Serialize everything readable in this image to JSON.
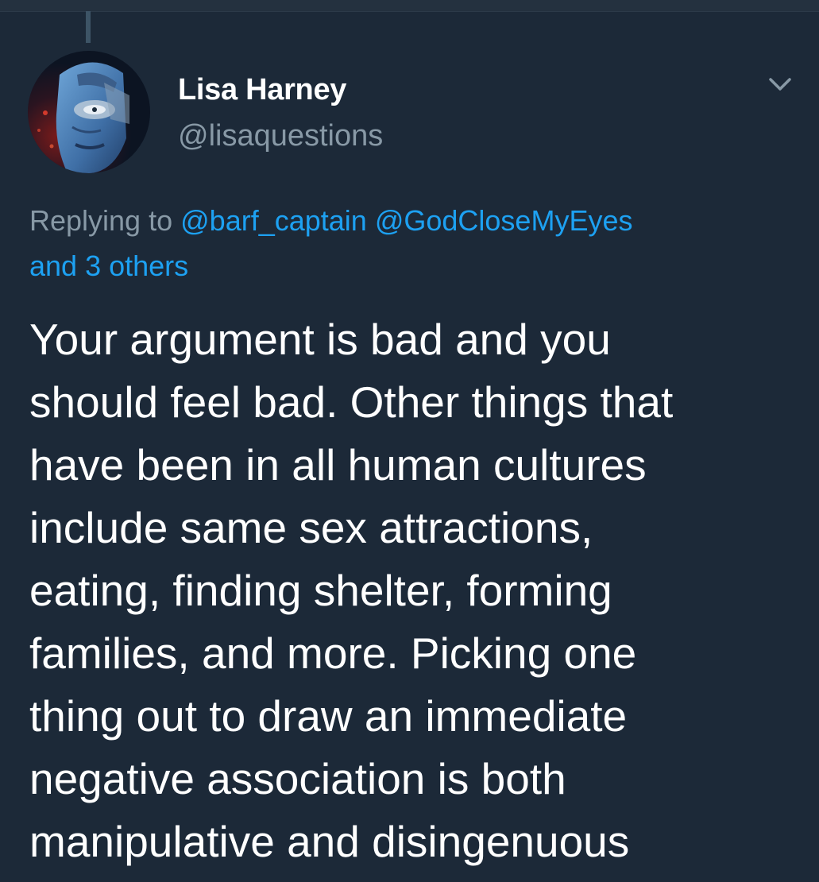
{
  "tweet": {
    "author": {
      "display_name": "Lisa Harney",
      "handle": "@lisaquestions",
      "avatar_icon": "user-avatar-portrait"
    },
    "menu_icon": "chevron-down-icon",
    "reply_context": {
      "prefix": "Replying to",
      "mentions": [
        "@barf_captain",
        "@GodCloseMyEyes"
      ],
      "others": "and 3 others"
    },
    "body_lines": [
      "Your argument is bad and you",
      "should feel bad. Other things that",
      "have been in all human cultures",
      "include same sex attractions,",
      "eating, finding shelter, forming",
      "families, and more. Picking one",
      "thing out to draw an immediate",
      "negative association is both",
      "manipulative and disingenuous"
    ]
  },
  "colors": {
    "background": "#1c2938",
    "text_primary": "#ffffff",
    "text_secondary": "#8899a6",
    "link": "#1da1f2",
    "thread_line": "#3d5466"
  }
}
